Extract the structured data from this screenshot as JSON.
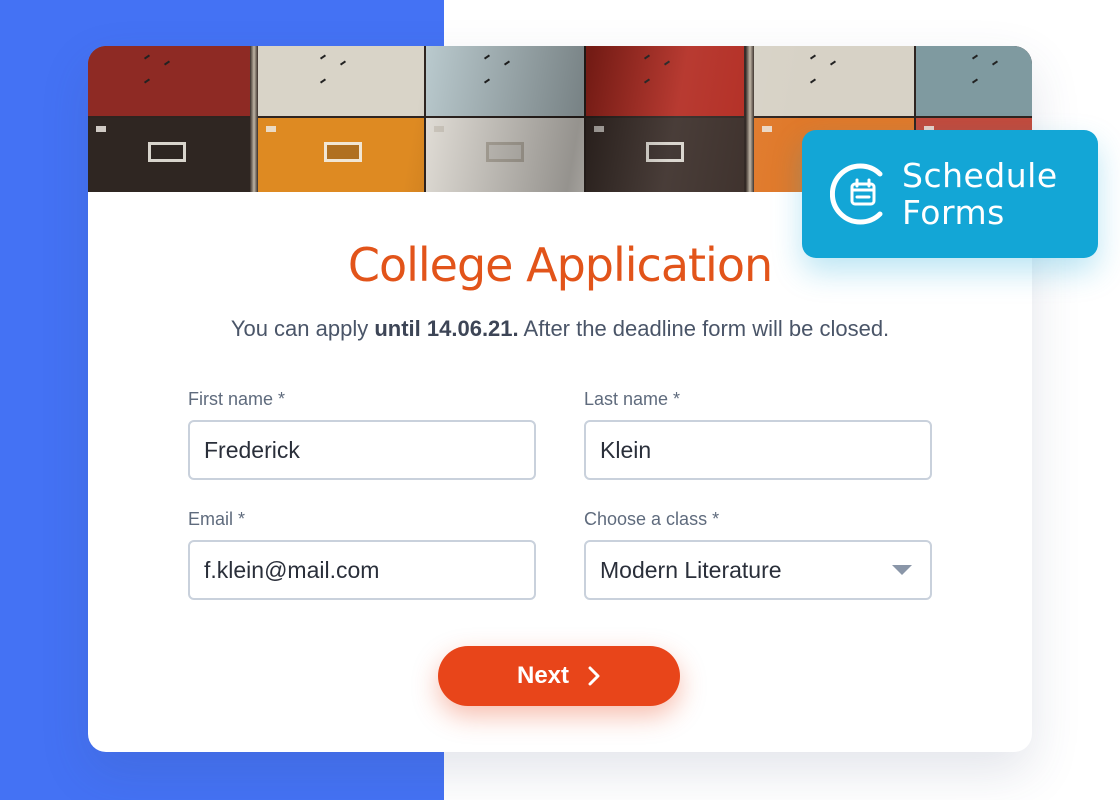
{
  "badge": {
    "line1": "Schedule",
    "line2": "Forms",
    "icon": "calendar-icon"
  },
  "form": {
    "title": "College Application",
    "subtitle_prefix": "You can apply ",
    "subtitle_bold": "until 14.06.21.",
    "subtitle_suffix": " After the deadline form will be closed.",
    "fields": {
      "first_name": {
        "label": "First name *",
        "value": "Frederick"
      },
      "last_name": {
        "label": "Last name *",
        "value": "Klein"
      },
      "email": {
        "label": "Email *",
        "value": "f.klein@mail.com"
      },
      "class": {
        "label": "Choose a class *",
        "value": "Modern Literature"
      }
    },
    "next_label": "Next"
  },
  "colors": {
    "accent_orange": "#e8451a",
    "title_orange": "#e2541a",
    "badge_blue": "#13a6d6",
    "background_blue": "#4472f4"
  }
}
